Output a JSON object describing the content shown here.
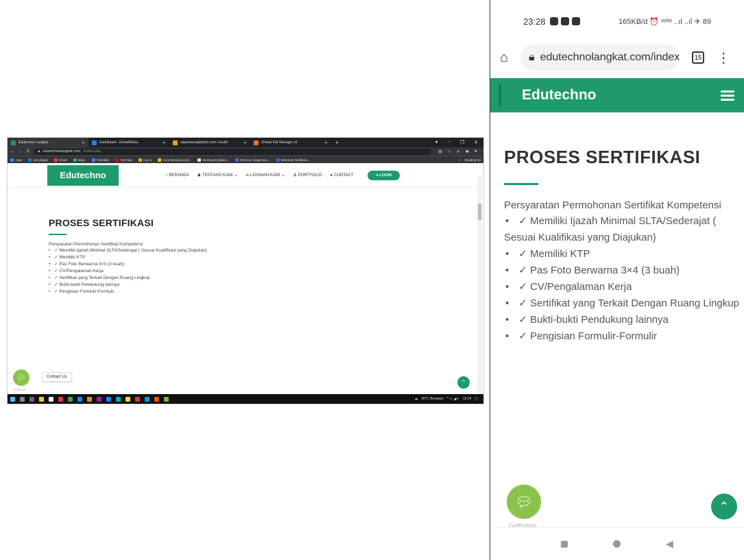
{
  "desktop": {
    "tabs": [
      {
        "label": "Edutechno Langkat",
        "color": "#1f9a6a"
      },
      {
        "label": "Dashboard - DomaiNesia",
        "color": "#2a7de1"
      },
      {
        "label": "vapeenesiapidyles.com / localh",
        "color": "#f4a300"
      },
      {
        "label": "cPanel File Manager v3",
        "color": "#ff6c2c"
      }
    ],
    "url_host": "edutechnolangkat.com",
    "url_path": "/index.php",
    "bookmarks": [
      "Apps",
      "cek plagiat",
      "Gmail",
      "Maps",
      "Translate",
      "YouTube",
      "Log In",
      "Cara Membuat Apli...",
      "Membuat Aplikasi...",
      "Remove Image Bac...",
      "Membuat Notifikasi..."
    ],
    "reading_list": "Reading list",
    "logo": "Edutechno",
    "nav": [
      "BERANDA",
      "TENTANG KAMI",
      "LAYANAN KAMI",
      "PORTFOLIO",
      "CONTACT"
    ],
    "login": "LOGIN",
    "contact_pill": "Contact Us",
    "getbutton_label": "GetButton",
    "tray_text": "30°C  Berawan",
    "tray_time": "19:24"
  },
  "content": {
    "title": "PROSES SERTIFIKASI",
    "intro": "Persyaratan Permohonan Sertifikat Kompetensi",
    "items": [
      "✓ Memiliki Ijazah Minimal SLTA/Sederajat ( Sesuai Kualifikasi yang Diajukan)",
      "✓ Memiliki KTP",
      "✓ Pas Foto Berwarna 3×4 (3 buah)",
      "✓ CV/Pengalaman Kerja",
      "✓ Sertifikat yang Terkait Dengan Ruang Lingkup",
      "✓ Bukti-bukti Pendukung lainnya",
      "✓ Pengisian Formulir-Formulir"
    ]
  },
  "phone": {
    "time": "23:28",
    "status_right": "165KB/d ⏰ ᵛᵒˡᵗᵉ ..ıl ..ıl ✈ 89",
    "url": "edutechnolangkat.com/index",
    "tab_count": "15",
    "logo": "Edutechno",
    "getbutton_label": "GetButton"
  },
  "colors": {
    "brand": "#1f9a6a",
    "getbutton": "#8bc34a"
  }
}
